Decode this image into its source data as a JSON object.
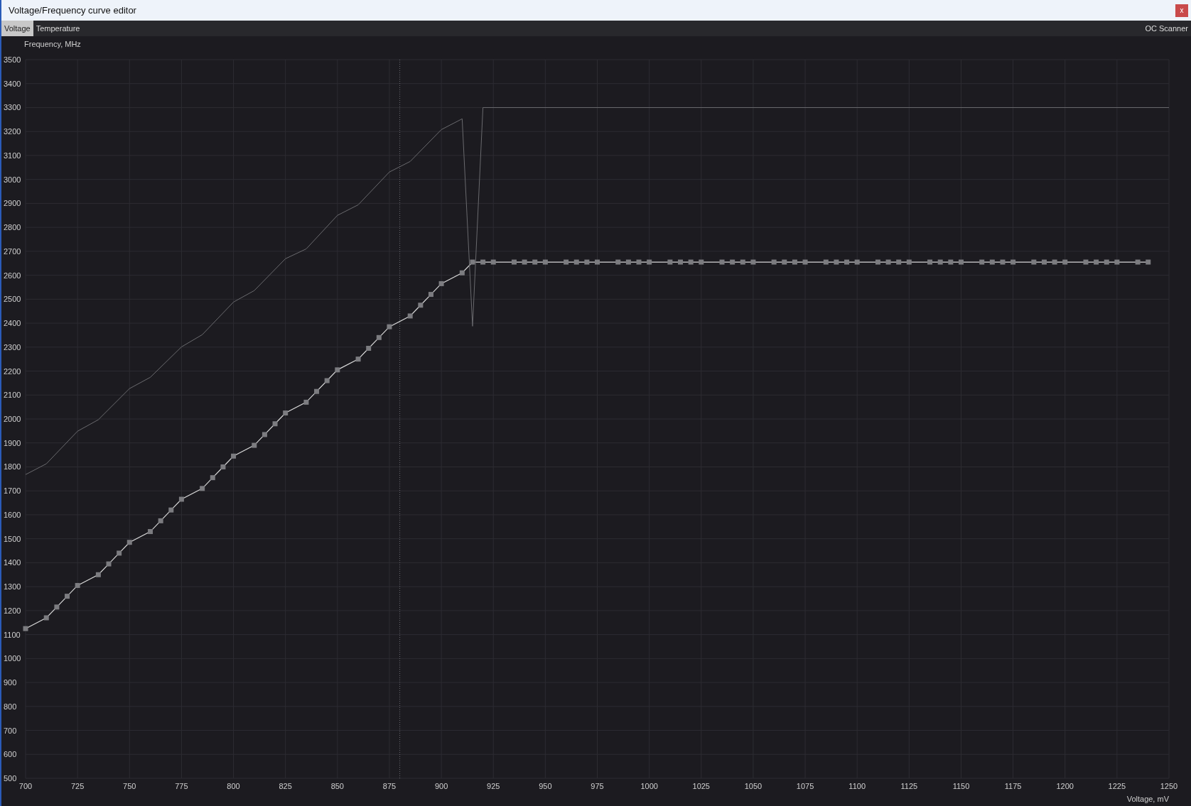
{
  "window": {
    "title": "Voltage/Frequency curve editor",
    "close": "x"
  },
  "tabs": [
    {
      "label": "Voltage",
      "selected": true
    },
    {
      "label": "Temperature",
      "selected": false
    }
  ],
  "right_tab": {
    "label": "OC Scanner"
  },
  "chart": {
    "chart_data": {
      "type": "line",
      "ylabel": "Frequency, MHz",
      "xlabel": "Voltage, mV",
      "xlim": [
        700,
        1250
      ],
      "ylim": [
        500,
        3500
      ],
      "xticks": [
        700,
        725,
        750,
        775,
        800,
        825,
        850,
        875,
        900,
        925,
        950,
        975,
        1000,
        1025,
        1050,
        1075,
        1100,
        1125,
        1150,
        1175,
        1200,
        1225,
        1250
      ],
      "yticks": [
        500,
        600,
        700,
        800,
        900,
        1000,
        1100,
        1200,
        1300,
        1400,
        1500,
        1600,
        1700,
        1800,
        1900,
        2000,
        2100,
        2200,
        2300,
        2400,
        2500,
        2600,
        2700,
        2800,
        2900,
        3000,
        3100,
        3200,
        3300,
        3400,
        3500
      ],
      "grid": true,
      "ref_lines": [
        {
          "axis": "x",
          "value": 880
        }
      ],
      "series": [
        {
          "color": "#d8d8d8",
          "marker": "square",
          "x": [
            700,
            710,
            715,
            720,
            725,
            735,
            740,
            745,
            750,
            760,
            765,
            770,
            775,
            785,
            790,
            795,
            800,
            810,
            815,
            820,
            825,
            835,
            840,
            845,
            850,
            860,
            865,
            870,
            875,
            885,
            890,
            895,
            900,
            910,
            915,
            920,
            925,
            935,
            940,
            945,
            950,
            960,
            965,
            970,
            975,
            985,
            990,
            995,
            1000,
            1010,
            1015,
            1020,
            1025,
            1035,
            1040,
            1045,
            1050,
            1060,
            1065,
            1070,
            1075,
            1085,
            1090,
            1095,
            1100,
            1110,
            1115,
            1120,
            1125,
            1135,
            1140,
            1145,
            1150,
            1160,
            1165,
            1170,
            1175,
            1185,
            1190,
            1195,
            1200,
            1210,
            1215,
            1220,
            1225,
            1235,
            1240
          ],
          "values": [
            1125,
            1170,
            1215,
            1260,
            1305,
            1350,
            1395,
            1440,
            1485,
            1530,
            1575,
            1620,
            1665,
            1710,
            1755,
            1800,
            1845,
            1890,
            1935,
            1980,
            2025,
            2070,
            2115,
            2160,
            2205,
            2250,
            2295,
            2340,
            2385,
            2430,
            2475,
            2520,
            2565,
            2610,
            2655,
            2655,
            2655,
            2655,
            2655,
            2655,
            2655,
            2655,
            2655,
            2655,
            2655,
            2655,
            2655,
            2655,
            2655,
            2655,
            2655,
            2655,
            2655,
            2655,
            2655,
            2655,
            2655,
            2655,
            2655,
            2655,
            2655,
            2655,
            2655,
            2655,
            2655,
            2655,
            2655,
            2655,
            2655,
            2655,
            2655,
            2655,
            2655,
            2655,
            2655,
            2655,
            2655,
            2655,
            2655,
            2655,
            2655,
            2655,
            2655,
            2655,
            2655,
            2655,
            2655
          ]
        },
        {
          "color": "#6a6a6e",
          "x": [
            700,
            710,
            725,
            735,
            750,
            760,
            775,
            785,
            800,
            810,
            825,
            835,
            850,
            860,
            875,
            885,
            900,
            910,
            915,
            920,
            1250
          ],
          "values": [
            1768,
            1813,
            1949,
            1997,
            2127,
            2174,
            2301,
            2352,
            2488,
            2536,
            2669,
            2710,
            2850,
            2894,
            3031,
            3075,
            3208,
            3253,
            2387,
            3300,
            3300
          ]
        }
      ]
    }
  }
}
